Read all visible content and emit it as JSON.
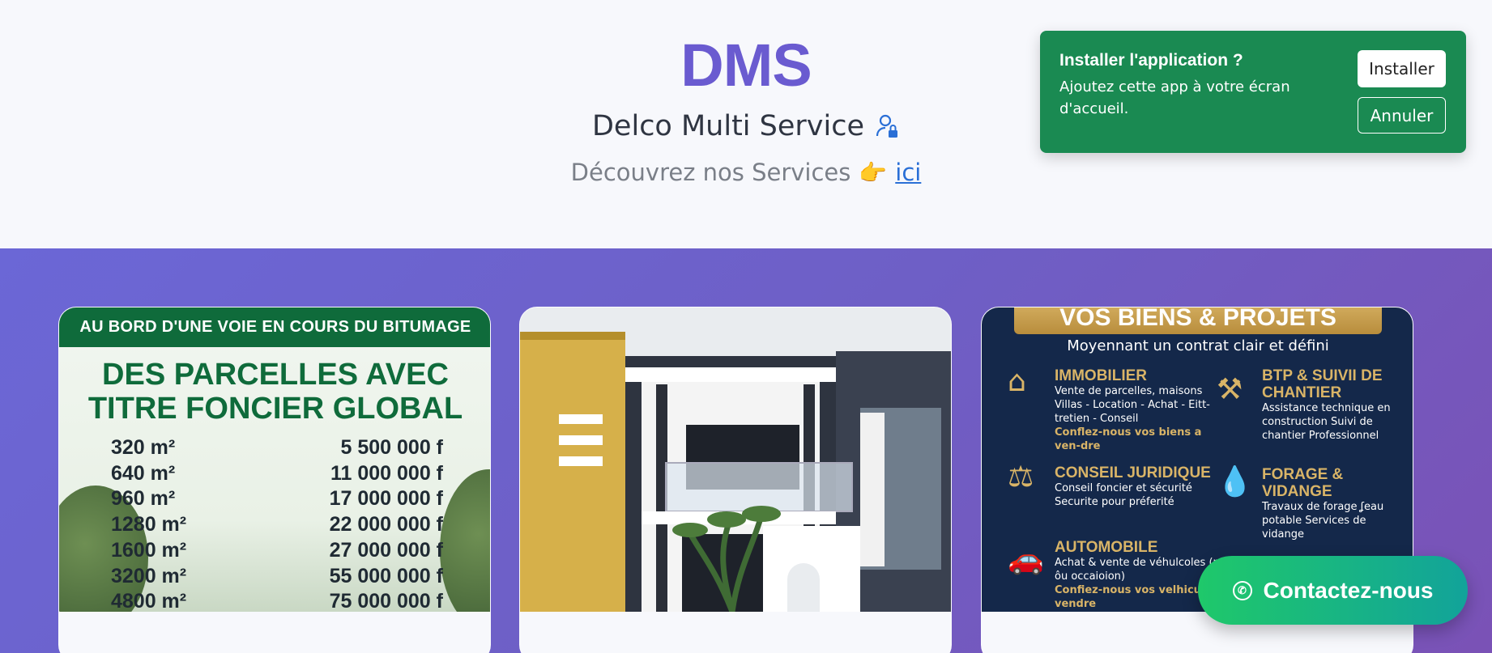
{
  "header": {
    "brand": "DMS",
    "subtitle": "Delco Multi Service",
    "discover_text": "Découvrez nos Services",
    "discover_link": "ici"
  },
  "install_prompt": {
    "title": "Installer l'application ?",
    "message": "Ajoutez cette app à votre écran d'accueil.",
    "install_label": "Installer",
    "cancel_label": "Annuler"
  },
  "cards": {
    "parcelles": {
      "ribbon": "AU BORD D'UNE VOIE EN COURS DU BITUMAGE",
      "headline_1": "DES PARCELLES AVEC",
      "headline_2": "TITRE FONCIER GLOBAL",
      "rows": [
        {
          "size": "320 m²",
          "price": "5 500 000 f"
        },
        {
          "size": "640 m²",
          "price": "11 000 000 f"
        },
        {
          "size": "960 m²",
          "price": "17 000 000 f"
        },
        {
          "size": "1280 m²",
          "price": "22 000 000 f"
        },
        {
          "size": "1600 m²",
          "price": "27 000 000 f"
        },
        {
          "size": "3200 m²",
          "price": "55 000 000 f"
        },
        {
          "size": "4800 m²",
          "price": "75 000 000 f"
        }
      ]
    },
    "services": {
      "banner": "VOS BIENS & PROJETS",
      "tagline": "Moyennant un contrat clair et défini",
      "items": [
        {
          "title": "IMMOBILIER",
          "desc": "Vente de parcelles, maisons Villas - Location - Achat - Eitt-tretien - Conseil",
          "highlight": "Conflez-nous vos biens a ven-dre"
        },
        {
          "title": "BTP & SUIVII DE CHANTIER",
          "desc": "Assistance technique en construction Suivi de chantier Professionnel",
          "highlight": ""
        },
        {
          "title": "CONSEIL JURIDIQUE",
          "desc": "Conseil foncier et sécurité Securite pour préferité",
          "highlight": ""
        },
        {
          "title": "FORAGE & VIDANGE",
          "desc": "Travaux de forage ʆeau potable Services de vidange",
          "highlight": ""
        },
        {
          "title": "AUTOMOBILE",
          "desc": "Achat & vente de véhulcoles (neut ôu occaioion)",
          "highlight": "Confiez-nous vos velhicule à vendre"
        }
      ]
    }
  },
  "contact_button": "Contactez-nous",
  "icons": {
    "subtitle": "user-lock-icon",
    "discover": "pointing-hand-icon",
    "contact": "whatsapp-icon"
  },
  "colors": {
    "brand": "#6a5bd0",
    "band_start": "#6b67d6",
    "band_end": "#7a52b6",
    "toast": "#1a8a52",
    "parcel_green": "#0f6b3b",
    "gold": "#d9b467",
    "navy": "#14284a"
  }
}
